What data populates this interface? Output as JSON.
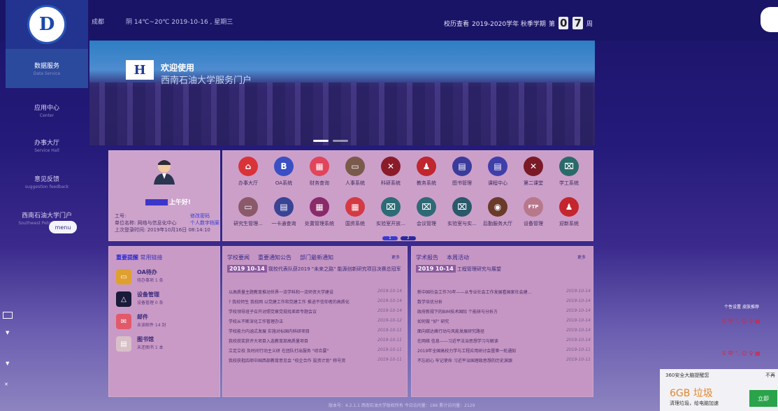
{
  "header": {
    "city": "成都",
    "weather": "阴 14℃~20℃  2019-10-16 , 星期三",
    "calendar_label": "校历查看",
    "semester": "2019-2020学年  秋季学期",
    "week_prefix": "第",
    "week_digit1": "0",
    "week_digit2": "7",
    "week_suffix": "周"
  },
  "sidebar": {
    "items": [
      {
        "label": "数据服务",
        "sub": "Data Service"
      },
      {
        "label": "应用中心",
        "sub": "Center"
      },
      {
        "label": "办事大厅",
        "sub": "Service Hall"
      },
      {
        "label": "意见反馈",
        "sub": "suggestion feedback"
      },
      {
        "label": "西南石油大学门户",
        "sub": "Southwest Petroleum Uni..."
      }
    ],
    "menu_label": "menu"
  },
  "banner": {
    "welcome": "欢迎使用",
    "title": "西南石油大学服务门户"
  },
  "profile": {
    "greeting": "上午好!",
    "id_label": "工号:",
    "unit_label": "单位名称:",
    "unit_value": "网络与信息化中心",
    "last_login_label": "上次登录时间:",
    "last_login_value": "2019年10月16日 08:14:10",
    "change_password": "修改密码",
    "personal_data": "个人数字档案"
  },
  "apps": [
    {
      "label": "办事大厅",
      "color": "#d9333a",
      "glyph": "⌂"
    },
    {
      "label": "OA系统",
      "color": "#3a4fc4",
      "glyph": "B"
    },
    {
      "label": "财务查询",
      "color": "#e0455c",
      "glyph": "▦"
    },
    {
      "label": "人事系统",
      "color": "#7a5a4a",
      "glyph": "▭"
    },
    {
      "label": "科研系统",
      "color": "#8a1c2a",
      "glyph": "✕"
    },
    {
      "label": "教务系统",
      "color": "#c0262e",
      "glyph": "♟"
    },
    {
      "label": "图书管理",
      "color": "#3b3b9c",
      "glyph": "▤"
    },
    {
      "label": "课程中心",
      "color": "#3f3faa",
      "glyph": "▤"
    },
    {
      "label": "第二课堂",
      "color": "#7a1a26",
      "glyph": "✕"
    },
    {
      "label": "学工系统",
      "color": "#2a6a6a",
      "glyph": "⌧"
    },
    {
      "label": "研究生管理...",
      "color": "#8a5a6a",
      "glyph": "▭"
    },
    {
      "label": "一卡通查询",
      "color": "#3a4494",
      "glyph": "▤"
    },
    {
      "label": "处置管理系统",
      "color": "#8a2a6a",
      "glyph": "▦"
    },
    {
      "label": "国资系统",
      "color": "#d43a44",
      "glyph": "▦"
    },
    {
      "label": "实验室开放...",
      "color": "#2c6c76",
      "glyph": "⌧"
    },
    {
      "label": "会议管理",
      "color": "#2e6a76",
      "glyph": "⌧"
    },
    {
      "label": "实验室与实...",
      "color": "#2a5a6a",
      "glyph": "⌧"
    },
    {
      "label": "后勤服务大厅",
      "color": "#6a3a2a",
      "glyph": "◉"
    },
    {
      "label": "设备管理",
      "color": "#b8788c",
      "glyph": "FTP"
    },
    {
      "label": "迎新系统",
      "color": "#c4262e",
      "glyph": "♟"
    }
  ],
  "pager": [
    "1",
    "2"
  ],
  "reminders": {
    "tab_active": "重要提醒",
    "tab_other": "常用链接",
    "items": [
      {
        "title": "OA待办",
        "sub": "待办事项 1 条",
        "color": "#e0a030",
        "icon": "▭"
      },
      {
        "title": "设备管理",
        "sub": "设备管理 0 条",
        "color": "#1a1a3a",
        "icon": "△"
      },
      {
        "title": "邮件",
        "sub": "未读邮件 14 封",
        "color": "#e25a6a",
        "icon": "✉"
      },
      {
        "title": "图书馆",
        "sub": "未还图书 1 本",
        "color": "#d8c0c8",
        "icon": "▤"
      }
    ]
  },
  "news_left": {
    "tabs": [
      "学校要闻",
      "重要通知公告",
      "部门最新通知"
    ],
    "more": "更多",
    "headline_tag": "2019 10-14",
    "headline": "我校代表队获2019 \"未来之路\" 能源创新研究项目决赛总冠军",
    "items": [
      {
        "text": "以高质量主题教育推动世界一流学科和一流师资大学建设",
        "date": "2019-10-14"
      },
      {
        "text": "? 我校师生 我校网 以党建工作和党建工作 推进不信仰者的高质化",
        "date": "2019-10-14"
      },
      {
        "text": "学校领导班子召开对照党章党规找差距专题会议",
        "date": "2019-10-14"
      },
      {
        "text": "学校从不断深化工作管理办法",
        "date": "2019-10-12"
      },
      {
        "text": "学校能力内涵式发展 实施对标国内科研项目",
        "date": "2019-10-11"
      },
      {
        "text": "我校获奖获评大项目入选教育部高质量项目",
        "date": "2019-10-11"
      },
      {
        "text": "立足立校 及时间行动主义研 在团队打出服务 \"综合要\"",
        "date": "2019-10-11"
      },
      {
        "text": "我校获批四项中国西部教育意见会 \"校企合作 投资计划\" 称号资",
        "date": "2019-10-11"
      }
    ]
  },
  "news_right": {
    "tabs": [
      "学术报告",
      "本周活动"
    ],
    "more": "更多",
    "headline_tag": "2019 10-14",
    "headline": "工程管理研究与展望",
    "items": [
      {
        "text": "新中国社会工作70年——从专业社会工作发展看国家社会建...",
        "date": "2019-10-14"
      },
      {
        "text": "数学培优分析",
        "date": "2019-10-14"
      },
      {
        "text": "政府新规下的BIM技术国际 个能研与分析方",
        "date": "2019-10-14"
      },
      {
        "text": "如何做 \"好\" 研究",
        "date": "2019-10-14"
      },
      {
        "text": "面向碳达峰行动与风能发展研究路径",
        "date": "2019-10-14"
      },
      {
        "text": "在网络 信息——习近平法治思想学习与解读",
        "date": "2019-10-14"
      },
      {
        "text": "2019年全国高校力学与工程应用研讨会暨第一轮通知",
        "date": "2019-10-11"
      },
      {
        "text": "不忘初心 牢记使命 习近平治国理政思想的历史渊源",
        "date": "2019-10-11"
      }
    ]
  },
  "ime": {
    "toolbar": "中 °, ☺ ♀ ▦",
    "tab1": "个性设置",
    "tab2": "皮肤推荐"
  },
  "popup": {
    "header": "360安全大脑提醒您",
    "close": "不再",
    "big": "6GB 垃圾",
    "sub": "清理垃圾，给电脑加速",
    "button": "立即"
  },
  "footer": "版本号：4.2.1.1  西南石油大学版权所有  今日访问量：186  累计访问量：2129"
}
